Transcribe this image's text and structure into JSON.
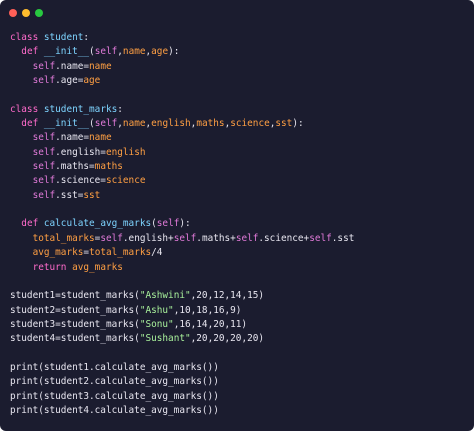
{
  "window": {
    "buttons": [
      "close",
      "minimize",
      "maximize"
    ],
    "colors": {
      "background": "#1b1c2f",
      "close": "#ff5f57",
      "minimize": "#febc2e",
      "maximize": "#28c840"
    }
  },
  "code": {
    "lines": [
      [
        {
          "t": "kw",
          "v": "class "
        },
        {
          "t": "fn",
          "v": "student"
        },
        {
          "t": "plain",
          "v": ":"
        }
      ],
      [
        {
          "t": "plain",
          "v": "  "
        },
        {
          "t": "kw",
          "v": "def "
        },
        {
          "t": "fn",
          "v": "__init__"
        },
        {
          "t": "plain",
          "v": "("
        },
        {
          "t": "self",
          "v": "self"
        },
        {
          "t": "plain",
          "v": ","
        },
        {
          "t": "param",
          "v": "name"
        },
        {
          "t": "plain",
          "v": ","
        },
        {
          "t": "param",
          "v": "age"
        },
        {
          "t": "plain",
          "v": "):"
        }
      ],
      [
        {
          "t": "plain",
          "v": "    "
        },
        {
          "t": "self",
          "v": "self"
        },
        {
          "t": "plain",
          "v": ".name="
        },
        {
          "t": "param",
          "v": "name"
        }
      ],
      [
        {
          "t": "plain",
          "v": "    "
        },
        {
          "t": "self",
          "v": "self"
        },
        {
          "t": "plain",
          "v": ".age="
        },
        {
          "t": "param",
          "v": "age"
        }
      ],
      [],
      [
        {
          "t": "kw",
          "v": "class "
        },
        {
          "t": "fn",
          "v": "student_marks"
        },
        {
          "t": "plain",
          "v": ":"
        }
      ],
      [
        {
          "t": "plain",
          "v": "  "
        },
        {
          "t": "kw",
          "v": "def "
        },
        {
          "t": "fn",
          "v": "__init__"
        },
        {
          "t": "plain",
          "v": "("
        },
        {
          "t": "self",
          "v": "self"
        },
        {
          "t": "plain",
          "v": ","
        },
        {
          "t": "param",
          "v": "name"
        },
        {
          "t": "plain",
          "v": ","
        },
        {
          "t": "param",
          "v": "english"
        },
        {
          "t": "plain",
          "v": ","
        },
        {
          "t": "param",
          "v": "maths"
        },
        {
          "t": "plain",
          "v": ","
        },
        {
          "t": "param",
          "v": "science"
        },
        {
          "t": "plain",
          "v": ","
        },
        {
          "t": "param",
          "v": "sst"
        },
        {
          "t": "plain",
          "v": "):"
        }
      ],
      [
        {
          "t": "plain",
          "v": "    "
        },
        {
          "t": "self",
          "v": "self"
        },
        {
          "t": "plain",
          "v": ".name="
        },
        {
          "t": "param",
          "v": "name"
        }
      ],
      [
        {
          "t": "plain",
          "v": "    "
        },
        {
          "t": "self",
          "v": "self"
        },
        {
          "t": "plain",
          "v": ".english="
        },
        {
          "t": "param",
          "v": "english"
        }
      ],
      [
        {
          "t": "plain",
          "v": "    "
        },
        {
          "t": "self",
          "v": "self"
        },
        {
          "t": "plain",
          "v": ".maths="
        },
        {
          "t": "param",
          "v": "maths"
        }
      ],
      [
        {
          "t": "plain",
          "v": "    "
        },
        {
          "t": "self",
          "v": "self"
        },
        {
          "t": "plain",
          "v": ".science="
        },
        {
          "t": "param",
          "v": "science"
        }
      ],
      [
        {
          "t": "plain",
          "v": "    "
        },
        {
          "t": "self",
          "v": "self"
        },
        {
          "t": "plain",
          "v": ".sst="
        },
        {
          "t": "param",
          "v": "sst"
        }
      ],
      [],
      [
        {
          "t": "plain",
          "v": "  "
        },
        {
          "t": "kw",
          "v": "def "
        },
        {
          "t": "fn",
          "v": "calculate_avg_marks"
        },
        {
          "t": "plain",
          "v": "("
        },
        {
          "t": "self",
          "v": "self"
        },
        {
          "t": "plain",
          "v": "):"
        }
      ],
      [
        {
          "t": "plain",
          "v": "    "
        },
        {
          "t": "assign",
          "v": "total_marks"
        },
        {
          "t": "plain",
          "v": "="
        },
        {
          "t": "self",
          "v": "self"
        },
        {
          "t": "plain",
          "v": ".english+"
        },
        {
          "t": "self",
          "v": "self"
        },
        {
          "t": "plain",
          "v": ".maths+"
        },
        {
          "t": "self",
          "v": "self"
        },
        {
          "t": "plain",
          "v": ".science+"
        },
        {
          "t": "self",
          "v": "self"
        },
        {
          "t": "plain",
          "v": ".sst"
        }
      ],
      [
        {
          "t": "plain",
          "v": "    "
        },
        {
          "t": "assign",
          "v": "avg_marks"
        },
        {
          "t": "plain",
          "v": "="
        },
        {
          "t": "assign",
          "v": "total_marks"
        },
        {
          "t": "plain",
          "v": "/4"
        }
      ],
      [
        {
          "t": "plain",
          "v": "    "
        },
        {
          "t": "kw",
          "v": "return "
        },
        {
          "t": "assign",
          "v": "avg_marks"
        }
      ],
      [],
      [
        {
          "t": "plain",
          "v": "student1=student_marks("
        },
        {
          "t": "str",
          "v": "\"Ashwini\""
        },
        {
          "t": "plain",
          "v": ",20,12,14,15)"
        }
      ],
      [
        {
          "t": "plain",
          "v": "student2=student_marks("
        },
        {
          "t": "str",
          "v": "\"Ashu\""
        },
        {
          "t": "plain",
          "v": ",10,18,16,9)"
        }
      ],
      [
        {
          "t": "plain",
          "v": "student3=student_marks("
        },
        {
          "t": "str",
          "v": "\"Sonu\""
        },
        {
          "t": "plain",
          "v": ",16,14,20,11)"
        }
      ],
      [
        {
          "t": "plain",
          "v": "student4=student_marks("
        },
        {
          "t": "str",
          "v": "\"Sushant\""
        },
        {
          "t": "plain",
          "v": ",20,20,20,20)"
        }
      ],
      [],
      [
        {
          "t": "plain",
          "v": "print(student1.calculate_avg_marks())"
        }
      ],
      [
        {
          "t": "plain",
          "v": "print(student2.calculate_avg_marks())"
        }
      ],
      [
        {
          "t": "plain",
          "v": "print(student3.calculate_avg_marks())"
        }
      ],
      [
        {
          "t": "plain",
          "v": "print(student4.calculate_avg_marks())"
        }
      ]
    ]
  }
}
